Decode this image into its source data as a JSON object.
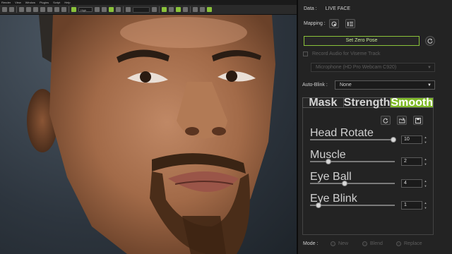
{
  "menubar": {
    "items": [
      "Render",
      "View",
      "Window",
      "Plugins",
      "Script",
      "Help"
    ]
  },
  "toolbar": {
    "preset": "High"
  },
  "panel": {
    "data_label": "Data :",
    "data_value": "LIVE FACE",
    "mapping_label": "Mapping :",
    "set_zero_pose": "Set Zero Pose",
    "record_audio": "Record Audio for Viseme Track",
    "audio_device": "Microphone (HD Pro Webcam C920)",
    "auto_blink_label": "Auto-Blink :",
    "auto_blink_value": "None",
    "tabs": [
      "Mask",
      "Strength",
      "Smooth"
    ],
    "sliders": [
      {
        "label": "Head Rotate",
        "value": "10",
        "fraction": 0.98
      },
      {
        "label": "Muscle",
        "value": "2",
        "fraction": 0.22
      },
      {
        "label": "Eye Ball",
        "value": "4",
        "fraction": 0.41
      },
      {
        "label": "Eye Blink",
        "value": "1",
        "fraction": 0.1
      }
    ],
    "mode_label": "Mode :",
    "modes": [
      "New",
      "Blend",
      "Replace"
    ]
  },
  "colors": {
    "accent": "#8ac23a",
    "panel_bg": "#232323"
  }
}
